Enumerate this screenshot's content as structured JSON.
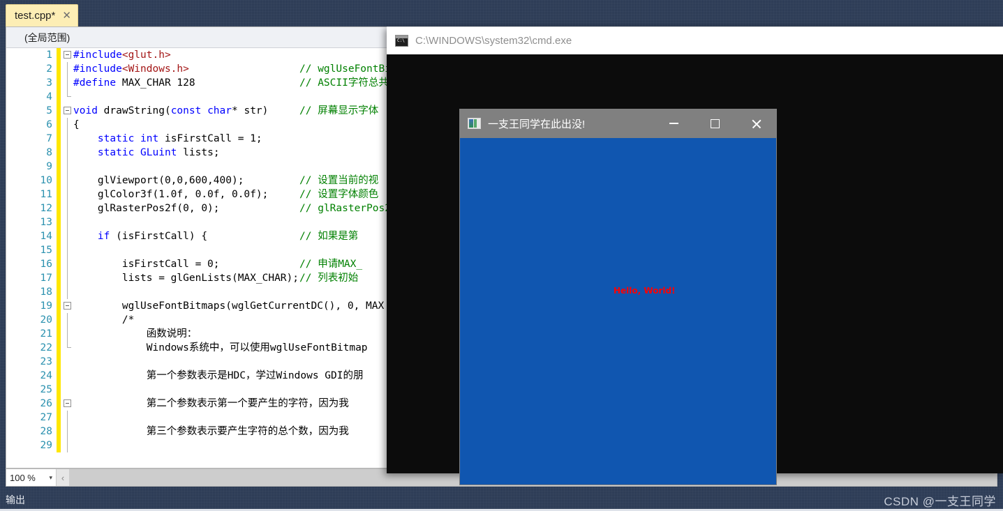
{
  "app": {
    "tab": {
      "label": "test.cpp*",
      "close_icon": "close-icon",
      "close_glyph": "✕"
    },
    "scope_bar": {
      "text": "(全局范围)"
    },
    "zoom": {
      "level": "100 %",
      "caret_glyph": "▾",
      "hscroll_left_glyph": "‹"
    },
    "bottom": {
      "output_label": "输出",
      "watermark": "CSDN @一支王同学"
    }
  },
  "editor": {
    "lines": [
      {
        "n": "1",
        "gutter": "box",
        "code": "#include<glut.h>",
        "comment": ""
      },
      {
        "n": "2",
        "gutter": "vline",
        "code": "#include<Windows.h>",
        "comment": "// wglUseFontBi"
      },
      {
        "n": "3",
        "gutter": "vline",
        "code": "#define MAX_CHAR 128",
        "comment": "// ASCII字符总共"
      },
      {
        "n": "4",
        "gutter": "vend",
        "code": "",
        "comment": ""
      },
      {
        "n": "5",
        "gutter": "box",
        "code": "void drawString(const char* str)",
        "comment": "// 屏幕显示字体"
      },
      {
        "n": "6",
        "gutter": "vline",
        "code": "{",
        "comment": ""
      },
      {
        "n": "7",
        "gutter": "vline",
        "code": "    static int isFirstCall = 1;",
        "comment": ""
      },
      {
        "n": "8",
        "gutter": "vline",
        "code": "    static GLuint lists;",
        "comment": ""
      },
      {
        "n": "9",
        "gutter": "vline",
        "code": "",
        "comment": ""
      },
      {
        "n": "10",
        "gutter": "vline",
        "code": "    glViewport(0,0,600,400);",
        "comment": "// 设置当前的视"
      },
      {
        "n": "11",
        "gutter": "vline",
        "code": "    glColor3f(1.0f, 0.0f, 0.0f);",
        "comment": "// 设置字体颜色"
      },
      {
        "n": "12",
        "gutter": "vline",
        "code": "    glRasterPos2f(0, 0);",
        "comment": "// glRasterPos2"
      },
      {
        "n": "13",
        "gutter": "vline",
        "code": "",
        "comment": ""
      },
      {
        "n": "14",
        "gutter": "vline",
        "code": "    if (isFirstCall) {",
        "comment": "// 如果是第"
      },
      {
        "n": "15",
        "gutter": "vline",
        "code": "",
        "comment": ""
      },
      {
        "n": "16",
        "gutter": "vline",
        "code": "        isFirstCall = 0;",
        "comment": "// 申请MAX_"
      },
      {
        "n": "17",
        "gutter": "vline",
        "code": "        lists = glGenLists(MAX_CHAR);",
        "comment": "// 列表初始"
      },
      {
        "n": "18",
        "gutter": "vline",
        "code": "",
        "comment": ""
      },
      {
        "n": "19",
        "gutter": "box",
        "code": "        wglUseFontBitmaps(wglGetCurrentDC(), 0, MAX",
        "comment": ""
      },
      {
        "n": "20",
        "gutter": "vline",
        "code": "        /*",
        "comment": ""
      },
      {
        "n": "21",
        "gutter": "vline",
        "code": "            函数说明：",
        "comment": ""
      },
      {
        "n": "22",
        "gutter": "vend",
        "code": "            Windows系统中，可以使用wglUseFontBitmap",
        "comment": ""
      },
      {
        "n": "23",
        "gutter": "",
        "code": "",
        "comment": ""
      },
      {
        "n": "24",
        "gutter": "",
        "code": "            第一个参数表示是HDC，学过Windows GDI的朋",
        "comment": ""
      },
      {
        "n": "25",
        "gutter": "",
        "code": "",
        "comment": ""
      },
      {
        "n": "26",
        "gutter": "box",
        "code": "            第二个参数表示第一个要产生的字符，因为我",
        "comment": ""
      },
      {
        "n": "27",
        "gutter": "vline",
        "code": "",
        "comment": ""
      },
      {
        "n": "28",
        "gutter": "vline",
        "code": "            第三个参数表示要产生字符的总个数，因为我",
        "comment": ""
      },
      {
        "n": "29",
        "gutter": "vline",
        "code": "",
        "comment": ""
      }
    ]
  },
  "cmd_window": {
    "title": "C:\\WINDOWS\\system32\\cmd.exe",
    "icon": "cmd-icon",
    "icon_glyph": "C:\\"
  },
  "glut_window": {
    "title": "一支王同学在此出没!",
    "icon": "app-icon",
    "controls": [
      {
        "name": "minimize-button",
        "glyph": "—"
      },
      {
        "name": "maximize-button",
        "glyph": "□"
      },
      {
        "name": "close-button",
        "glyph": "✕"
      }
    ],
    "canvas": {
      "background_color": "#1056b0",
      "text": "Hello, World!",
      "text_color": "#ff0000"
    }
  },
  "colors": {
    "vs_chrome": "#2e3d57",
    "tab_active": "#fdeeb5",
    "editor_bg": "#ffffff",
    "comment_green": "#008000",
    "keyword_blue": "#0000ff",
    "string_red": "#a31515",
    "line_number": "#2b91af",
    "change_margin": "#ffe700",
    "gl_blue": "#1056b0",
    "gl_text_red": "#ff0000",
    "glut_titlebar": "#808080",
    "cmd_bg": "#0c0c0c"
  }
}
